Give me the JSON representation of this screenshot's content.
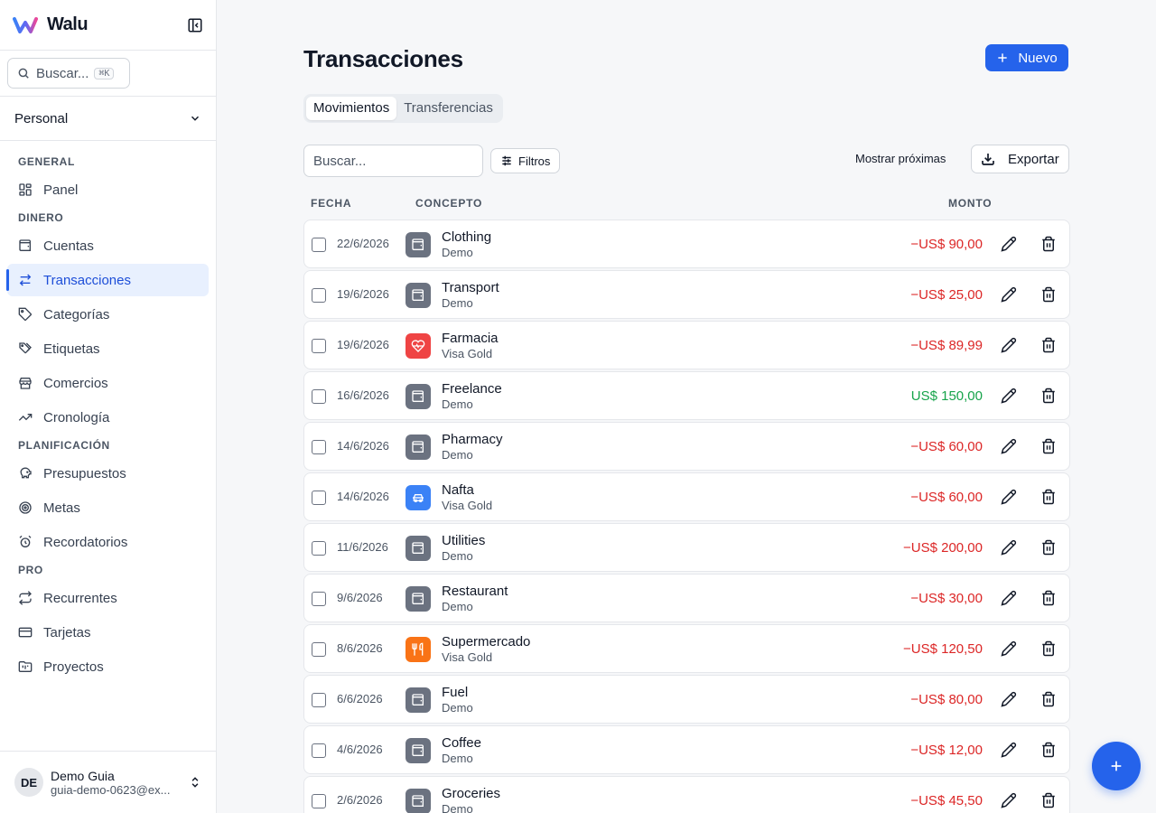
{
  "app": {
    "name": "Walu"
  },
  "sidebar": {
    "search_label": "Buscar...",
    "search_shortcut": "⌘K",
    "workspace": "Personal",
    "sections": [
      {
        "title": "GENERAL",
        "items": [
          {
            "label": "Panel",
            "icon": "layout-dashboard-icon"
          }
        ]
      },
      {
        "title": "DINERO",
        "items": [
          {
            "label": "Cuentas",
            "icon": "wallet-icon"
          },
          {
            "label": "Transacciones",
            "icon": "arrows-left-right-icon",
            "active": true
          },
          {
            "label": "Categorías",
            "icon": "tag-icon"
          },
          {
            "label": "Etiquetas",
            "icon": "tags-icon"
          },
          {
            "label": "Comercios",
            "icon": "store-icon"
          },
          {
            "label": "Cronología",
            "icon": "trending-up-icon"
          }
        ]
      },
      {
        "title": "PLANIFICACIÓN",
        "items": [
          {
            "label": "Presupuestos",
            "icon": "piggy-bank-icon"
          },
          {
            "label": "Metas",
            "icon": "target-icon"
          },
          {
            "label": "Recordatorios",
            "icon": "alarm-clock-icon"
          }
        ]
      },
      {
        "title": "PRO",
        "items": [
          {
            "label": "Recurrentes",
            "icon": "repeat-icon"
          },
          {
            "label": "Tarjetas",
            "icon": "credit-card-icon"
          },
          {
            "label": "Proyectos",
            "icon": "folder-kanban-icon"
          }
        ]
      }
    ],
    "user": {
      "initials": "DE",
      "name": "Demo Guia",
      "email": "guia-demo-0623@ex..."
    }
  },
  "main": {
    "title": "Transacciones",
    "new_button": "Nuevo",
    "tabs": [
      {
        "label": "Movimientos",
        "active": true
      },
      {
        "label": "Transferencias",
        "active": false
      }
    ],
    "search_placeholder": "Buscar...",
    "filters_label": "Filtros",
    "show_upcoming": "Mostrar próximas",
    "export_label": "Exportar",
    "columns": {
      "date": "FECHA",
      "concept": "CONCEPTO",
      "amount": "MONTO"
    },
    "rows": [
      {
        "date": "22/6/2026",
        "desc": "Clothing",
        "account": "Demo",
        "amount": "−US$ 90,00",
        "type": "expense",
        "icon": "wallet-icon",
        "color": "#6b7280"
      },
      {
        "date": "19/6/2026",
        "desc": "Transport",
        "account": "Demo",
        "amount": "−US$ 25,00",
        "type": "expense",
        "icon": "wallet-icon",
        "color": "#6b7280"
      },
      {
        "date": "19/6/2026",
        "desc": "Farmacia",
        "account": "Visa Gold",
        "amount": "−US$ 89,99",
        "type": "expense",
        "icon": "heart-pulse-icon",
        "color": "#ef4444"
      },
      {
        "date": "16/6/2026",
        "desc": "Freelance",
        "account": "Demo",
        "amount": "US$ 150,00",
        "type": "income",
        "icon": "wallet-icon",
        "color": "#6b7280"
      },
      {
        "date": "14/6/2026",
        "desc": "Pharmacy",
        "account": "Demo",
        "amount": "−US$ 60,00",
        "type": "expense",
        "icon": "wallet-icon",
        "color": "#6b7280"
      },
      {
        "date": "14/6/2026",
        "desc": "Nafta",
        "account": "Visa Gold",
        "amount": "−US$ 60,00",
        "type": "expense",
        "icon": "car-icon",
        "color": "#3b82f6"
      },
      {
        "date": "11/6/2026",
        "desc": "Utilities",
        "account": "Demo",
        "amount": "−US$ 200,00",
        "type": "expense",
        "icon": "wallet-icon",
        "color": "#6b7280"
      },
      {
        "date": "9/6/2026",
        "desc": "Restaurant",
        "account": "Demo",
        "amount": "−US$ 30,00",
        "type": "expense",
        "icon": "wallet-icon",
        "color": "#6b7280"
      },
      {
        "date": "8/6/2026",
        "desc": "Supermercado",
        "account": "Visa Gold",
        "amount": "−US$ 120,50",
        "type": "expense",
        "icon": "utensils-icon",
        "color": "#f97316"
      },
      {
        "date": "6/6/2026",
        "desc": "Fuel",
        "account": "Demo",
        "amount": "−US$ 80,00",
        "type": "expense",
        "icon": "wallet-icon",
        "color": "#6b7280"
      },
      {
        "date": "4/6/2026",
        "desc": "Coffee",
        "account": "Demo",
        "amount": "−US$ 12,00",
        "type": "expense",
        "icon": "wallet-icon",
        "color": "#6b7280"
      },
      {
        "date": "2/6/2026",
        "desc": "Groceries",
        "account": "Demo",
        "amount": "−US$ 45,50",
        "type": "expense",
        "icon": "wallet-icon",
        "color": "#6b7280"
      }
    ]
  },
  "colors": {
    "accent": "#2563eb",
    "expense": "#dc2626",
    "income": "#16a34a"
  }
}
